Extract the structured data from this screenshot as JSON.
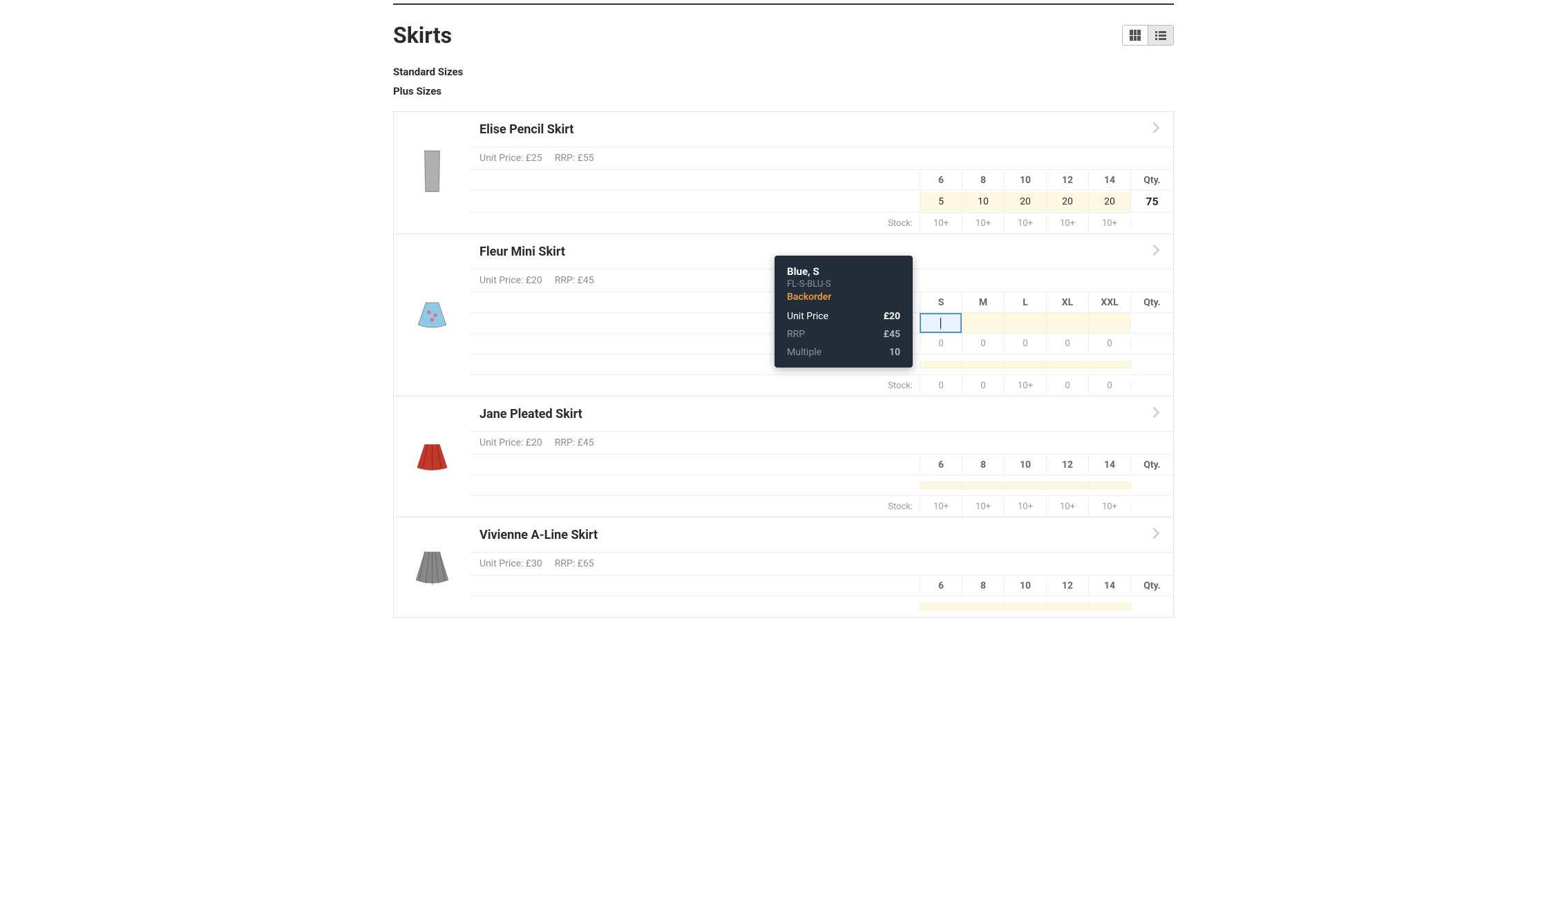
{
  "heading": "Skirts",
  "subcats": {
    "standard": "Standard Sizes",
    "plus": "Plus Sizes"
  },
  "stock_label": "Stock:",
  "qty_label": "Qty.",
  "unit_price_label": "Unit Price:",
  "rrp_label": "RRP:",
  "tooltip": {
    "title": "Blue, S",
    "sku": "FL-S-BLU-S",
    "status": "Backorder",
    "unit_price_label": "Unit Price",
    "unit_price_val": "£20",
    "rrp_label": "RRP",
    "rrp_val": "£45",
    "multiple_label": "Multiple",
    "multiple_val": "10"
  },
  "products": [
    {
      "name": "Elise Pencil Skirt",
      "unit_price": "£25",
      "rrp": "£55",
      "thumb_color": "#b0b0b0",
      "sizes": [
        "6",
        "8",
        "10",
        "12",
        "14"
      ],
      "qtys": [
        "5",
        "10",
        "20",
        "20",
        "20"
      ],
      "total": "75",
      "stock": [
        "10+",
        "10+",
        "10+",
        "10+",
        "10+"
      ]
    },
    {
      "name": "Fleur Mini Skirt",
      "unit_price": "£20",
      "rrp": "£45",
      "thumb_color": "#8ecae6",
      "sizes": [
        "S",
        "M",
        "L",
        "XL",
        "XXL"
      ],
      "qtys_active_index": 0,
      "qtys": [
        "",
        "",
        "",
        "",
        ""
      ],
      "total": "",
      "stock": [
        "0",
        "0",
        "0",
        "0",
        "0"
      ],
      "extra_row": true,
      "extra_stock": [
        "0",
        "0",
        "10+",
        "0",
        "0"
      ]
    },
    {
      "name": "Jane Pleated Skirt",
      "unit_price": "£20",
      "rrp": "£45",
      "thumb_color": "#c0392b",
      "sizes": [
        "6",
        "8",
        "10",
        "12",
        "14"
      ],
      "qtys": [
        "",
        "",
        "",
        "",
        ""
      ],
      "total": "",
      "stock": [
        "10+",
        "10+",
        "10+",
        "10+",
        "10+"
      ]
    },
    {
      "name": "Vivienne A-Line Skirt",
      "unit_price": "£30",
      "rrp": "£65",
      "thumb_color": "#888",
      "sizes": [
        "6",
        "8",
        "10",
        "12",
        "14"
      ],
      "qtys": [
        "",
        "",
        "",
        "",
        ""
      ],
      "total": "",
      "stock": []
    }
  ]
}
